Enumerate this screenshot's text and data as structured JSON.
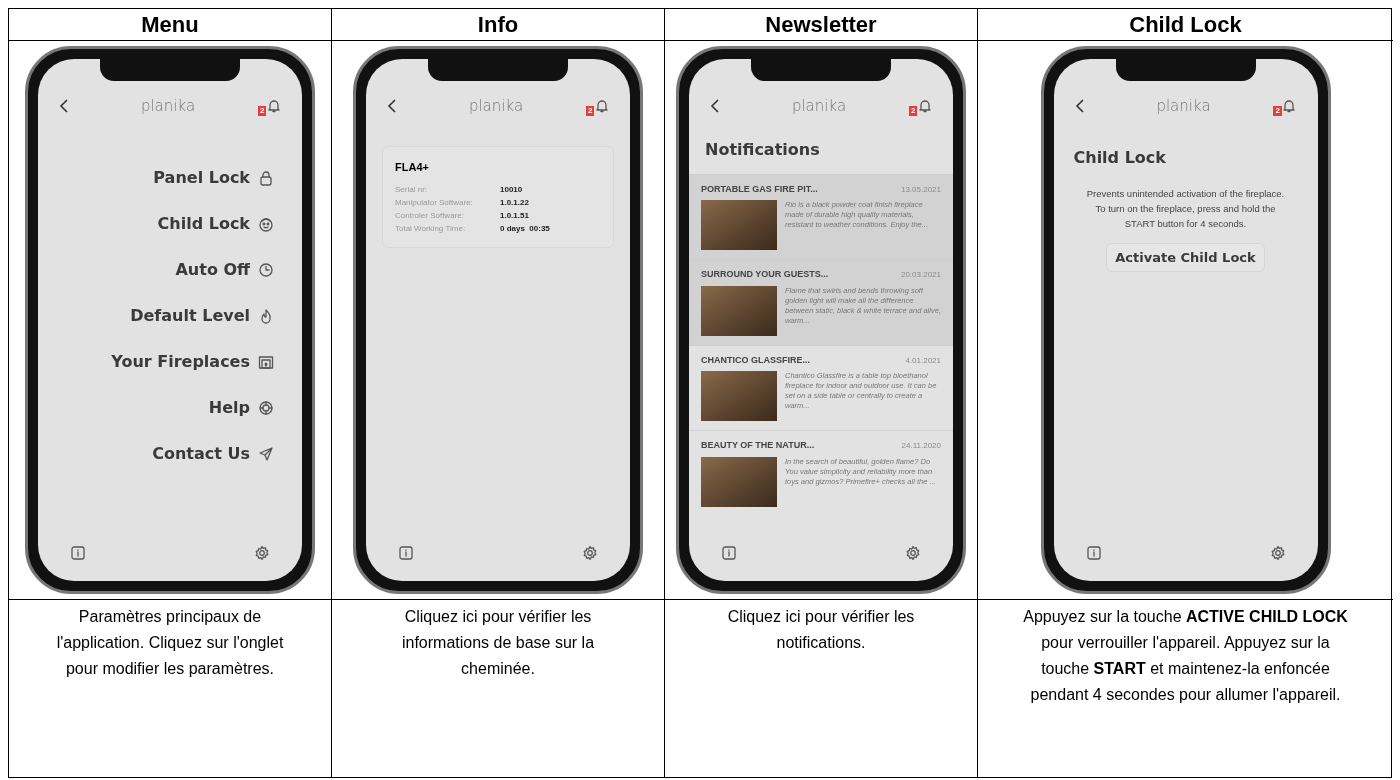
{
  "columns": [
    {
      "heading": "Menu",
      "screen": {
        "kind": "menu",
        "logo": "planika",
        "badge": "2",
        "items": [
          "Panel Lock",
          "Child Lock",
          "Auto Off",
          "Default Level",
          "Your Fireplaces",
          "Help",
          "Contact Us"
        ]
      },
      "caption": "Paramètres principaux de l'application. Cliquez sur l'onglet pour modifier les paramètres."
    },
    {
      "heading": "Info",
      "screen": {
        "kind": "info",
        "logo": "planika",
        "badge": "2",
        "device": "FLA4+",
        "rows": [
          {
            "label": "Serial nr:",
            "value": "10010"
          },
          {
            "label": "Manipulator Software:",
            "value": "1.0.1.22"
          },
          {
            "label": "Controler Software:",
            "value": "1.0.1.51"
          },
          {
            "label": "Total Working Time:",
            "value": "0 days  00:35"
          }
        ]
      },
      "caption": "Cliquez ici pour vérifier les informations de base sur la cheminée."
    },
    {
      "heading": "Newsletter",
      "screen": {
        "kind": "notifications",
        "logo": "planika",
        "badge": "2",
        "title": "Notifications",
        "items": [
          {
            "title": "PORTABLE GAS FIRE PIT...",
            "date": "13.05.2021",
            "text": "Rio is a black powder coat finish fireplace made of durable high quality materials, resistant to weather conditions. Enjoy the...",
            "highlighted": true
          },
          {
            "title": "SURROUND YOUR GUESTS...",
            "date": "20.03.2021",
            "text": "Flame that swirls and bends throwing soft golden light will make all the difference between static, black & white terrace and alive, warm...",
            "highlighted": true
          },
          {
            "title": "CHANTICO GLASSFIRE...",
            "date": "4.01.2021",
            "text": "Chantico Glassfire is a table top bioethanol fireplace for indoor and outdoor use. It can be set on a side table or centrally to create a warm...",
            "highlighted": false
          },
          {
            "title": "BEAUTY OF THE NATUR...",
            "date": "24.11.2020",
            "text": "In the search of beautiful, golden flame? Do You value simplicity and reliability more than toys and gizmos? Primefire+ checks all the ...",
            "highlighted": false
          }
        ]
      },
      "caption": "Cliquez ici pour vérifier les notifications."
    },
    {
      "heading": "Child Lock",
      "screen": {
        "kind": "child_lock",
        "logo": "planika",
        "badge": "2",
        "title": "Child Lock",
        "description": "Prevents unintended activation of the fireplace. To turn on the fireplace, press and hold the START button for 4 seconds.",
        "button": "Activate Child Lock"
      },
      "caption": "Appuyez sur la touche **ACTIVE CHILD LOCK** pour verrouiller l'appareil. Appuyez sur la touche **START** et maintenez-la enfoncée pendant 4 secondes pour allumer l'appareil."
    }
  ]
}
